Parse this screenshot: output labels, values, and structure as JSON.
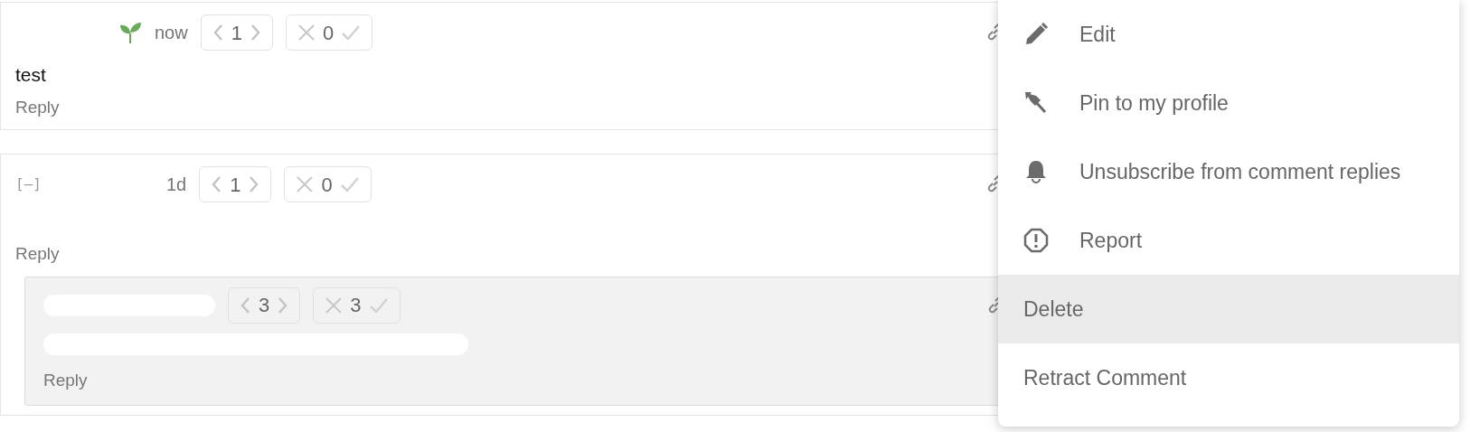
{
  "comments": [
    {
      "new_user": true,
      "time": "now",
      "karma": "1",
      "agreement": "0",
      "body": "test",
      "reply": "Reply"
    },
    {
      "collapse_toggle": "[–]",
      "new_user": false,
      "time": "1d",
      "karma": "1",
      "agreement": "0",
      "reply": "Reply",
      "children": [
        {
          "new_user": false,
          "karma": "3",
          "agreement": "3",
          "reply": "Reply"
        }
      ]
    }
  ],
  "menu": {
    "items": [
      {
        "label": "Edit",
        "kind": "icon",
        "selected": false
      },
      {
        "label": "Pin to my profile",
        "kind": "icon",
        "selected": false
      },
      {
        "label": "Unsubscribe from comment replies",
        "kind": "icon",
        "selected": false
      },
      {
        "label": "Report",
        "kind": "icon",
        "selected": false
      },
      {
        "label": "Delete",
        "kind": "plain",
        "selected": true
      },
      {
        "label": "Retract Comment",
        "kind": "plain",
        "selected": false
      }
    ]
  }
}
